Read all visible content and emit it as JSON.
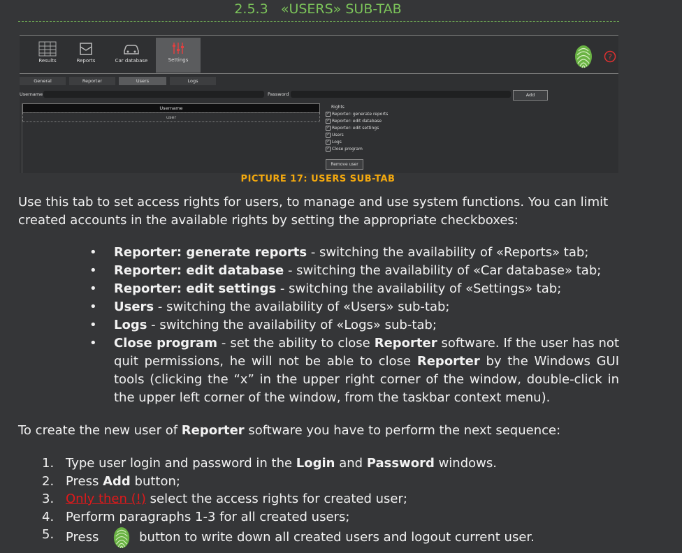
{
  "section": {
    "number": "2.5.3",
    "title": "«USERS» SUB-TAB"
  },
  "screenshot": {
    "nav_tabs": [
      {
        "label": "Results",
        "icon": "results-icon"
      },
      {
        "label": "Reports",
        "icon": "reports-icon"
      },
      {
        "label": "Car database",
        "icon": "car-icon"
      },
      {
        "label": "Settings",
        "icon": "settings-icon",
        "active": true
      }
    ],
    "sub_tabs": [
      {
        "label": "General"
      },
      {
        "label": "Reporter"
      },
      {
        "label": "Users",
        "active": true
      },
      {
        "label": "Logs"
      }
    ],
    "username_label": "Username",
    "password_label": "Password",
    "add_button": "Add",
    "table_header": "Username",
    "table_rows": [
      "user"
    ],
    "rights_title": "Rights",
    "rights": [
      {
        "label": "Reporter: generate reports",
        "checked": true
      },
      {
        "label": "Reporter: edit database",
        "checked": true
      },
      {
        "label": "Reporter: edit settings",
        "checked": true
      },
      {
        "label": "Users",
        "checked": true
      },
      {
        "label": "Logs",
        "checked": true
      },
      {
        "label": "Close program",
        "checked": true
      }
    ],
    "remove_button": "Remove user"
  },
  "caption": "PICTURE 17: USERS SUB-TAB",
  "intro": "Use this tab to set access rights for users, to manage and use system functions. You can limit created accounts in the available rights by setting the appropriate checkboxes:",
  "bullets": [
    {
      "term": "Reporter: generate reports",
      "text": " - switching the availability of «Reports» tab;"
    },
    {
      "term": "Reporter: edit database",
      "text": " - switching the availability of «Car database» tab;"
    },
    {
      "term": "Reporter: edit settings",
      "text": " - switching the availability of «Settings» tab;"
    },
    {
      "term": "Users",
      "text": " - switching the availability of «Users» sub-tab;"
    },
    {
      "term": "Logs",
      "text": " - switching the availability of «Logs» sub-tab;"
    }
  ],
  "close_bullet": {
    "term": "Close program",
    "t1": " - set the ability to close ",
    "b1": "Reporter",
    "t2": " software. If the user has not quit permissions, he will not be able to close ",
    "b2": "Reporter",
    "t3": " by the Windows GUI tools (clicking the “x” in the upper right corner of the window, double-click in the upper left corner of the window, from the taskbar context menu)."
  },
  "create_intro": {
    "t1": "To create the new user of ",
    "b1": "Reporter",
    "t2": " software you have to perform the next sequence:"
  },
  "steps": {
    "s1": {
      "n": "1.",
      "t1": "Type user login and password in the ",
      "b1": "Login",
      "t2": " and ",
      "b2": "Password",
      "t3": " windows."
    },
    "s2": {
      "n": "2.",
      "t1": "Press ",
      "b1": "Add",
      "t2": " button;"
    },
    "s3": {
      "n": "3.",
      "warn": "Only then (!)",
      "t1": " select the access rights for created user;"
    },
    "s4": {
      "n": "4.",
      "t1": "Perform paragraphs 1-3 for all created users;"
    },
    "s5": {
      "n": "5.",
      "t1": "Press",
      "t2": "button to write down all created users and logout current user."
    }
  },
  "bullet_glyph": "•",
  "colors": {
    "heading": "#7cc45a",
    "caption": "#f4a90e",
    "warning": "#e0191b",
    "background": "#353638"
  }
}
